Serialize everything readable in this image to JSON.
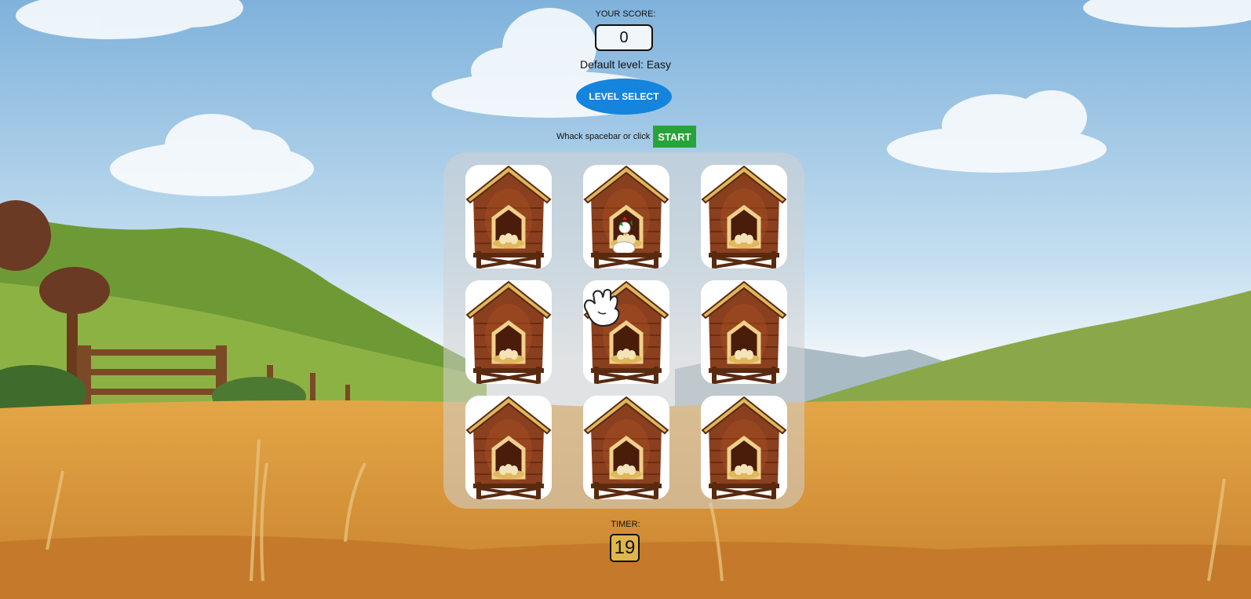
{
  "score": {
    "label": "YOUR SCORE:",
    "value": "0"
  },
  "level": {
    "text": "Default level: Easy",
    "button_label": "LEVEL SELECT"
  },
  "start": {
    "hint": "Whack spacebar or click",
    "button_label": "START"
  },
  "grid": {
    "rows": 3,
    "cols": 3,
    "holes": [
      {
        "id": 1,
        "state": "empty"
      },
      {
        "id": 2,
        "state": "chicken"
      },
      {
        "id": 3,
        "state": "empty"
      },
      {
        "id": 4,
        "state": "empty"
      },
      {
        "id": 5,
        "state": "empty"
      },
      {
        "id": 6,
        "state": "empty"
      },
      {
        "id": 7,
        "state": "empty"
      },
      {
        "id": 8,
        "state": "empty"
      },
      {
        "id": 9,
        "state": "empty"
      }
    ]
  },
  "timer": {
    "label": "TIMER:",
    "value": "19"
  },
  "cursor": {
    "icon": "glove-hand-icon"
  },
  "colors": {
    "sky": "#8fbde0",
    "field": "#d99a3a",
    "hill": "#6e9a35",
    "level_button": "#1584dc",
    "start_button": "#28a33a",
    "coop_wood": "#7a3a1c"
  }
}
